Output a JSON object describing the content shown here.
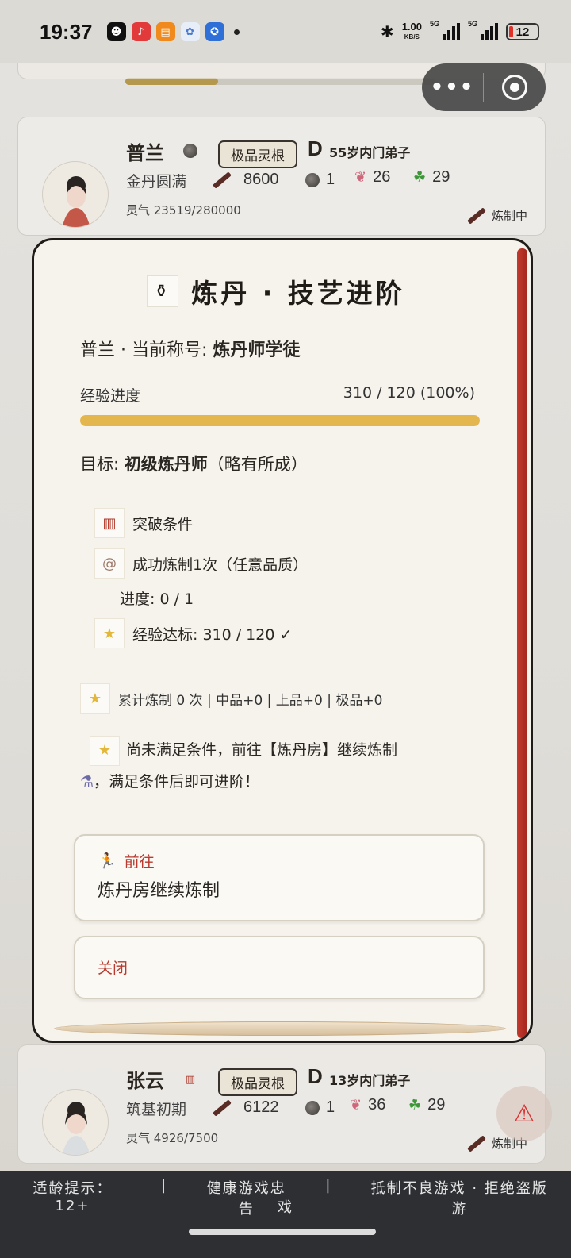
{
  "status_bar": {
    "time": "19:37",
    "speed_value": "1.00",
    "speed_unit": "KB/S",
    "network_1": "5G",
    "network_2": "5G",
    "battery": "12"
  },
  "capsule": {
    "more_label": "•••"
  },
  "cards": [
    {
      "name": "普兰",
      "root_badge": "极品灵根",
      "grade": "D",
      "age_rank": "55岁内门弟子",
      "realm": "金丹圆满",
      "attack": "8600",
      "count": "1",
      "intellect": "26",
      "luck": "29",
      "qi": "灵气 23519/280000",
      "status": "炼制中"
    },
    {
      "name": "张云",
      "root_badge": "极品灵根",
      "grade": "D",
      "age_rank": "13岁内门弟子",
      "realm": "筑基初期",
      "attack": "6122",
      "count": "1",
      "intellect": "36",
      "luck": "29",
      "qi": "灵气 4926/7500",
      "status": "炼制中"
    }
  ],
  "modal": {
    "title": "炼丹 · 技艺进阶",
    "title_prefix": "普兰 · 当前称号: ",
    "current_title": "炼丹师学徒",
    "exp_label": "经验进度",
    "exp_value": "310 / 120 (100%)",
    "exp_progress": 1.0,
    "goal_prefix": "目标: ",
    "goal_name": "初级炼丹师",
    "goal_suffix": "（略有所成）",
    "requirements_header": "突破条件",
    "req_1": "成功炼制1次（任意品质）",
    "req_1_progress": "进度: 0 / 1",
    "req_2": "经验达标: 310 / 120 ✓",
    "tally": "累计炼制 0 次 | 中品+0 | 上品+0 | 极品+0",
    "hint_1": "尚未满足条件，前往【炼丹房】继续炼制",
    "hint_2": "，满足条件后即可进阶！",
    "go_label": "前往",
    "go_desc": "炼丹房继续炼制",
    "close_label": "关闭"
  },
  "footer": {
    "age_tip": "适龄提示：12+",
    "sep": "|",
    "health": "健康游戏忠告",
    "anti_1": "抵制不良游戏 · 拒绝盗版游",
    "anti_2": "戏"
  },
  "colors": {
    "accent_red": "#b93a2e",
    "progress_gold": "#e4b64e",
    "scroll_rod": "#c23b2f"
  }
}
